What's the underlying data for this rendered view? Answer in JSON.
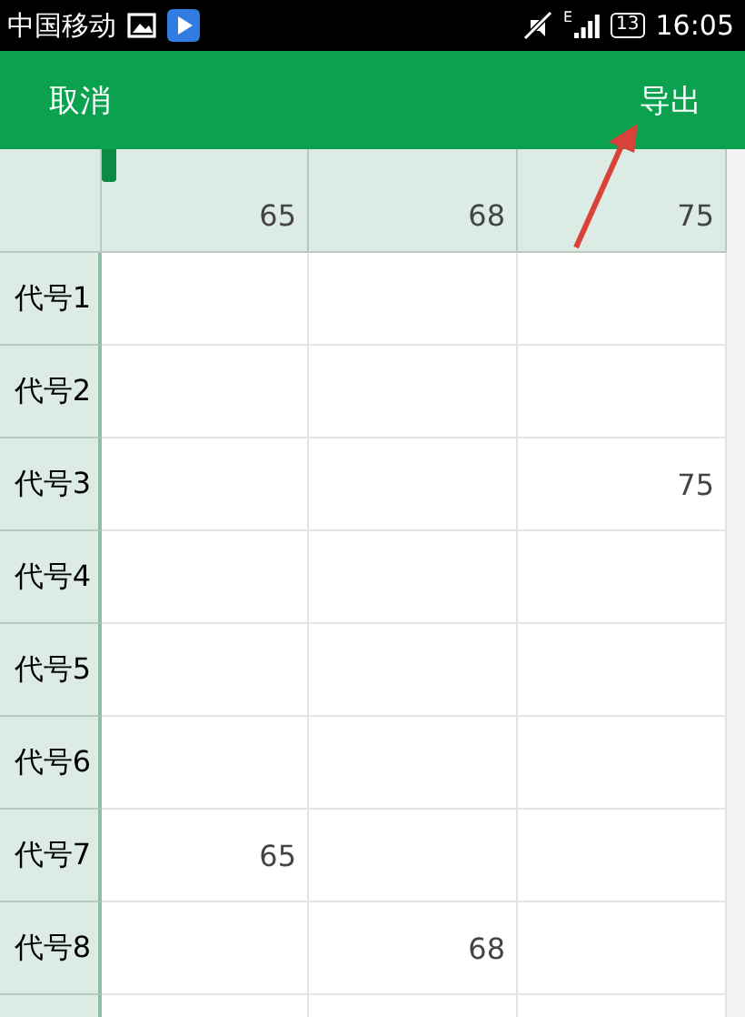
{
  "status_bar": {
    "carrier": "中国移动",
    "network": "E",
    "battery": "13",
    "time": "16:05"
  },
  "app_bar": {
    "left_action": "取消",
    "right_action": "导出"
  },
  "table": {
    "columns": [
      "65",
      "68",
      "75"
    ],
    "rows": [
      {
        "label": "代号1"
      },
      {
        "label": "代号2"
      },
      {
        "label": "代号3",
        "col_3": "75"
      },
      {
        "label": "代号4"
      },
      {
        "label": "代号5"
      },
      {
        "label": "代号6"
      },
      {
        "label": "代号7",
        "col_1": "65"
      },
      {
        "label": "代号8",
        "col_2": "68"
      }
    ]
  }
}
